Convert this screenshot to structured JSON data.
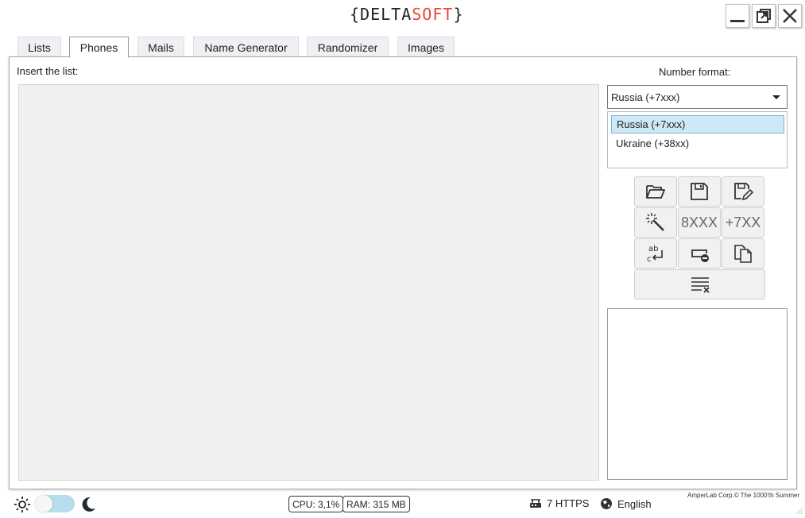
{
  "window": {
    "logo": {
      "brace_open": "{",
      "part1": "DELTA",
      "part2": "SOFT",
      "brace_close": "}"
    },
    "controls": [
      "minimize-icon",
      "restore-icon",
      "close-icon"
    ]
  },
  "tabs": [
    {
      "label": "Lists",
      "active": false
    },
    {
      "label": "Phones",
      "active": true
    },
    {
      "label": "Mails",
      "active": false
    },
    {
      "label": "Name Generator",
      "active": false
    },
    {
      "label": "Randomizer",
      "active": false
    },
    {
      "label": "Images",
      "active": false
    }
  ],
  "phones": {
    "insert_label": "Insert the list:",
    "format_label": "Number format:",
    "selected_format": "Russia (+7xxx)",
    "format_options": [
      "Russia (+7xxx)",
      "Ukraine (+38xx)"
    ],
    "tools": {
      "open": "folder-open-icon",
      "save": "save-icon",
      "save_edit": "save-edit-icon",
      "magic": "magic-wand-icon",
      "fmt8": "8XXX",
      "fmt7": "+7XX",
      "replace": "text-replace-icon",
      "remove": "remove-field-icon",
      "copy": "copy-icon",
      "clear": "clear-list-icon"
    }
  },
  "status": {
    "theme": {
      "light_icon": "sun-icon",
      "dark_icon": "moon-icon",
      "dark_mode": false
    },
    "cpu": "CPU: 3,1%",
    "ram": "RAM: 315 MB",
    "proxies": "7 HTTPS",
    "language": "English",
    "credit": "AmperLab Corp.© The 1000'th Summer"
  },
  "colors": {
    "accent_red": "#e8473a",
    "selection_bg": "#cfe8f6",
    "toggle_track": "#b7dcec"
  }
}
